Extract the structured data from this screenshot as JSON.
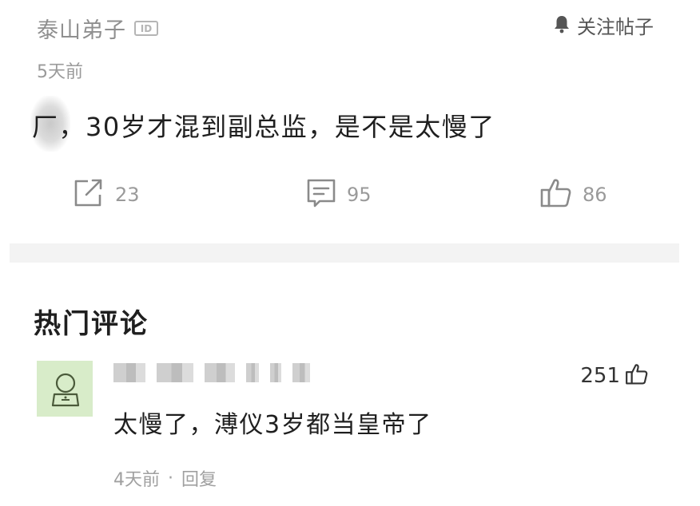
{
  "post": {
    "author": "泰山弟子",
    "id_badge": "ID",
    "follow_label": "关注帖子",
    "time": "5天前",
    "text": "厂，30岁才混到副总监，是不是太慢了",
    "actions": {
      "share_count": "23",
      "comment_count": "95",
      "like_count": "86"
    }
  },
  "hot_comments": {
    "title": "热门评论",
    "items": [
      {
        "like_count": "251",
        "text": "太慢了，溥仪3岁都当皇帝了",
        "time": "4天前",
        "separator": "·",
        "reply_label": "回复"
      }
    ]
  },
  "icons": {
    "bell": "bell-icon",
    "share": "share-icon",
    "comment": "comment-icon",
    "like": "thumbs-up-icon"
  },
  "colors": {
    "text_primary": "#1f1f1f",
    "text_muted": "#9a9a9a",
    "avatar_bg": "#d8ecc9",
    "divider": "#f3f3f3"
  }
}
